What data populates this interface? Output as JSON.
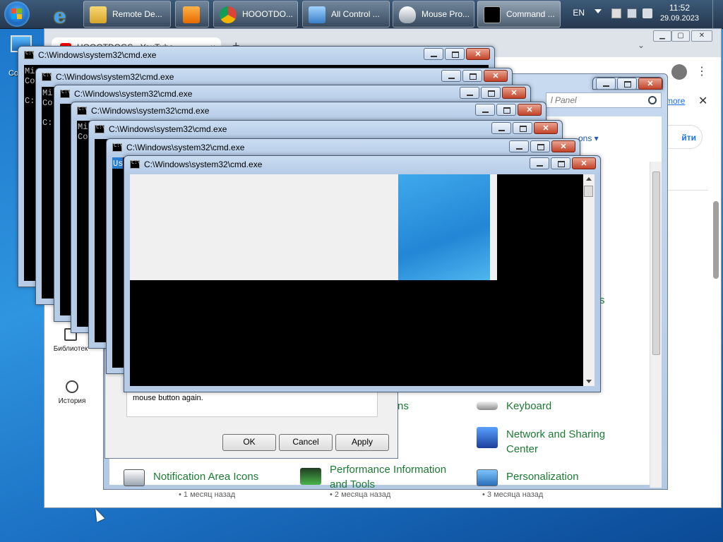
{
  "taskbar": {
    "buttons": [
      {
        "label": "Remote De..."
      },
      {
        "label": "HOOOTDO..."
      },
      {
        "label": "All Control ..."
      },
      {
        "label": "Mouse Pro..."
      },
      {
        "label": "Command ..."
      }
    ],
    "lang": "EN",
    "time": "11:52",
    "date": "29.09.2023"
  },
  "desktop": {
    "icon_label": "Co"
  },
  "browser": {
    "tab_title": "HOOOTDOGS - YouTube",
    "tab_close": "×",
    "new_tab": "+",
    "notice_link": "more",
    "notice_close": "✕",
    "login_button": "йти",
    "sidebar": [
      {
        "label": "Библиотек"
      },
      {
        "label": "История"
      }
    ],
    "meta": [
      "• 1 месяц назад",
      "• 2 месяца назад",
      "• 3 месяца назад"
    ]
  },
  "control_panel": {
    "search_placeholder": "l Panel",
    "view_label": "ons ▾",
    "partial_s": "s",
    "partial_ns": "ns",
    "items": [
      {
        "label": "Keyboard"
      },
      {
        "label": "Network and Sharing Center"
      },
      {
        "label": "Notification Area Icons"
      },
      {
        "label": "Performance Information and Tools"
      },
      {
        "label": "Personalization"
      }
    ]
  },
  "mouse_properties": {
    "hint_text": "mouse button again.",
    "ok": "OK",
    "cancel": "Cancel",
    "apply": "Apply"
  },
  "cmd": {
    "title": "C:\\Windows\\system32\\cmd.exe",
    "console_lines_1": "Mi\nCo\n\nC:",
    "console_lines_2": "Mi\nCo\n\nC:",
    "console_lines_4": "Mi\nCo",
    "console_lines_6": "Us"
  }
}
